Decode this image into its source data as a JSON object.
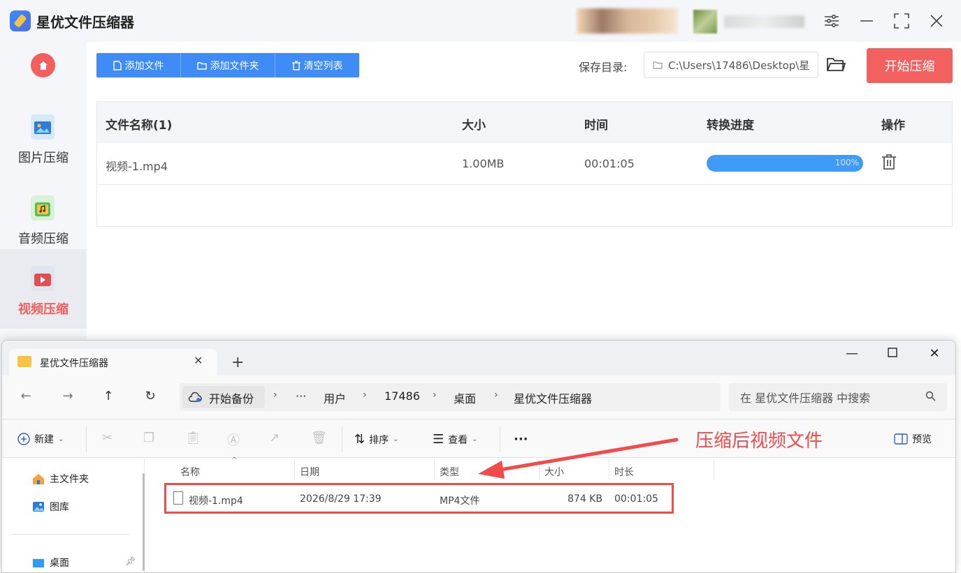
{
  "app": {
    "title": "星优文件压缩器",
    "sidebar": {
      "items": [
        {
          "label": "图片压缩",
          "icon": "image-icon",
          "active": false
        },
        {
          "label": "音频压缩",
          "icon": "audio-icon",
          "active": false
        },
        {
          "label": "视频压缩",
          "icon": "video-icon",
          "active": true
        }
      ]
    },
    "toolbar": {
      "add_file": "添加文件",
      "add_folder": "添加文件夹",
      "clear_list": "清空列表"
    },
    "save": {
      "label": "保存目录:",
      "path": "C:\\Users\\17486\\Desktop\\星"
    },
    "start_button": "开始压缩",
    "table": {
      "headers": [
        "文件名称(1)",
        "大小",
        "时间",
        "转换进度",
        "操作"
      ],
      "rows": [
        {
          "name": "视频-1.mp4",
          "size": "1.00MB",
          "time": "00:01:05",
          "progress": 100,
          "progress_text": "100%"
        }
      ]
    },
    "colors": {
      "accent": "#3f8cf6",
      "danger": "#f2615f",
      "progress": "#3f9bf5"
    }
  },
  "explorer": {
    "tab_title": "星优文件压缩器",
    "address": {
      "root": "开始备份",
      "ellipsis": "···",
      "crumbs": [
        "用户",
        "17486",
        "桌面",
        "星优文件压缩器"
      ]
    },
    "search_placeholder": "在 星优文件压缩器 中搜索",
    "commands": {
      "new": "新建",
      "sort": "排序",
      "view": "查看",
      "more": "···",
      "preview": "预览"
    },
    "annotation": "压缩后视频文件",
    "nav": [
      {
        "label": "主文件夹"
      },
      {
        "label": "图库"
      },
      {
        "label": "桌面"
      }
    ],
    "columns": [
      "名称",
      "日期",
      "类型",
      "大小",
      "时长"
    ],
    "files": [
      {
        "name": "视频-1.mp4",
        "date": "2026/8/29 17:39",
        "type": "MP4文件",
        "size": "874 KB",
        "duration": "00:01:05"
      }
    ],
    "annotation_color": "#f24b4b"
  }
}
